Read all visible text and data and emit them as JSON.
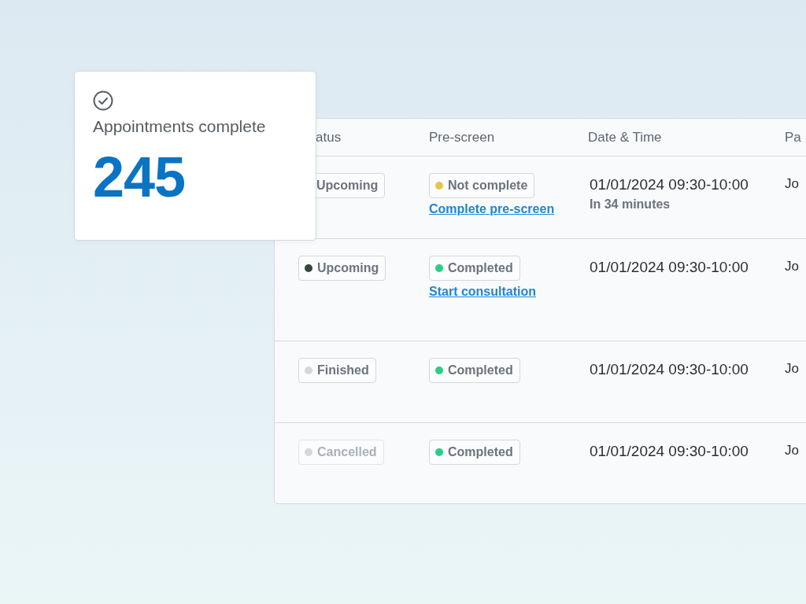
{
  "stat_card": {
    "label": "Appointments complete",
    "value": "245"
  },
  "table": {
    "columns": [
      "atus",
      "Pre-screen",
      "Date & Time",
      "Pa"
    ],
    "rows": [
      {
        "status": {
          "label": "Upcoming",
          "disabled": false
        },
        "prescreen": {
          "label": "Not complete",
          "color": "#e9c44a"
        },
        "action_link": "Complete pre-screen",
        "date": "01/01/2024 09:30-10:00",
        "date_note": "In 34 minutes",
        "column_4": "Jo"
      },
      {
        "status": {
          "label": "Upcoming",
          "disabled": false,
          "color": "#36463c"
        },
        "prescreen": {
          "label": "Completed",
          "color": "#2ecc85"
        },
        "action_link": "Start consultation",
        "date": "01/01/2024 09:30-10:00",
        "column_4": "Jo"
      },
      {
        "status": {
          "label": "Finished",
          "disabled": false,
          "color": "#d5d9de"
        },
        "prescreen": {
          "label": "Completed",
          "color": "#2ecc85"
        },
        "date": "01/01/2024 09:30-10:00",
        "column_4": "Jo"
      },
      {
        "status": {
          "label": "Cancelled",
          "disabled": true,
          "color": "#d5d9de"
        },
        "prescreen": {
          "label": "Completed",
          "color": "#2ecc85"
        },
        "date": "01/01/2024 09:30-10:00",
        "column_4": "Jo"
      }
    ]
  }
}
